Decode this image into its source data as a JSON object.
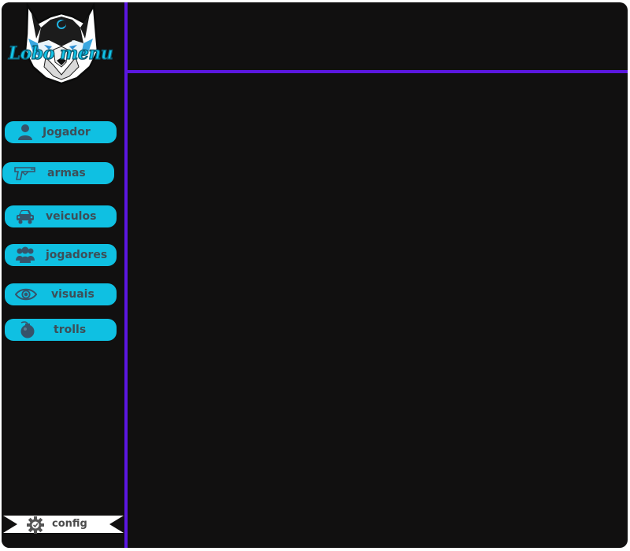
{
  "app": {
    "logo_text": "Lobo menu",
    "logo_icon": "wolf-icon"
  },
  "colors": {
    "background": "#111010",
    "accent": "#5b17e0",
    "button": "#0fc0e2",
    "button_text": "#3d4e57"
  },
  "sidebar": {
    "items": [
      {
        "label": "Jogador",
        "icon": "person-icon"
      },
      {
        "label": "armas",
        "icon": "pistol-icon"
      },
      {
        "label": "veiculos",
        "icon": "car-icon"
      },
      {
        "label": "jogadores",
        "icon": "group-icon"
      },
      {
        "label": "visuais",
        "icon": "eye-icon"
      },
      {
        "label": "trolls",
        "icon": "bomb-icon"
      }
    ],
    "config": {
      "label": "config",
      "icon": "gear-icon"
    }
  }
}
